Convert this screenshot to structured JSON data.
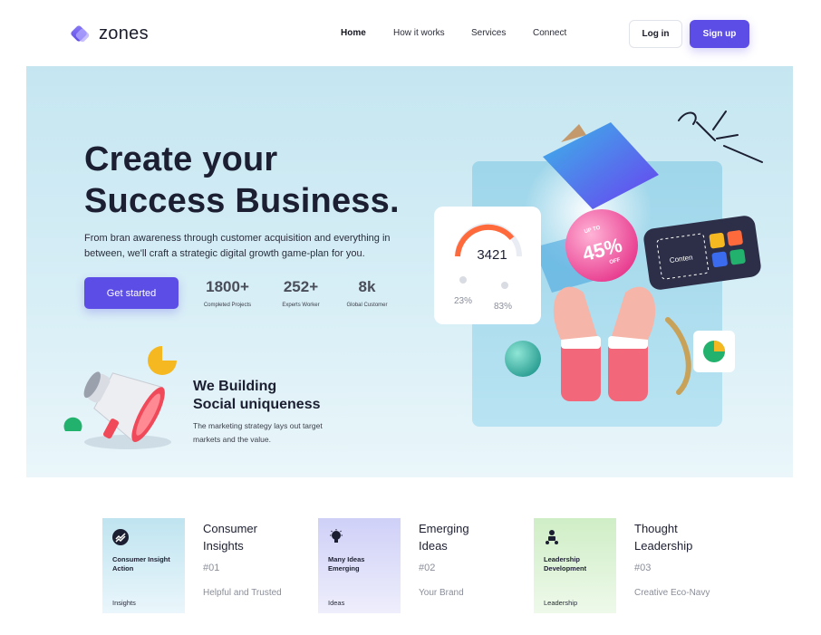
{
  "brand": {
    "name": "zones",
    "accent": "#5b4de6"
  },
  "nav": {
    "links": [
      "Home",
      "How it works",
      "Services",
      "Connect"
    ],
    "active": "Home",
    "login_label": "Log in",
    "signup_label": "Sign up"
  },
  "hero": {
    "title_line1": "Create your",
    "title_line2": "Success Business.",
    "subtitle": "From bran awareness through customer acquisition and everything in between, we'll craft a strategic digital growth game-plan for you.",
    "cta_label": "Get started",
    "stats": [
      {
        "value": "1800+",
        "label": "Completed Projects"
      },
      {
        "value": "252+",
        "label": "Experts Worker"
      },
      {
        "value": "8k",
        "label": "Global Customer"
      }
    ],
    "feature_title_line1": "We Building",
    "feature_title_line2": "Social uniqueness",
    "feature_desc": "The marketing strategy lays out target markets and the value."
  },
  "illustration": {
    "gauge_value": "3421",
    "gauge_pct_left": "23%",
    "gauge_pct_right": "83%",
    "badge_top": "UP TO",
    "badge_value": "45%",
    "badge_bottom": "OFF",
    "content_label": "Conten",
    "tile_colors": [
      "#f5b820",
      "#ff6a3d",
      "#3b6cf0",
      "#23b26d"
    ]
  },
  "cards": [
    {
      "tile_title": "Consumer Insight Action",
      "tile_foot": "Insights",
      "title_line1": "Consumer",
      "title_line2": "Insights",
      "number": "#01",
      "desc": "Helpful and Trusted",
      "icon": "trend-icon"
    },
    {
      "tile_title": "Many Ideas Emerging",
      "tile_foot": "Ideas",
      "title_line1": "Emerging",
      "title_line2": "Ideas",
      "number": "#02",
      "desc": "Your Brand",
      "icon": "lightbulb-icon"
    },
    {
      "tile_title": "Leadership Development",
      "tile_foot": "Leadership",
      "title_line1": "Thought",
      "title_line2": "Leadership",
      "number": "#03",
      "desc": "Creative Eco-Navy",
      "icon": "leader-icon"
    }
  ]
}
